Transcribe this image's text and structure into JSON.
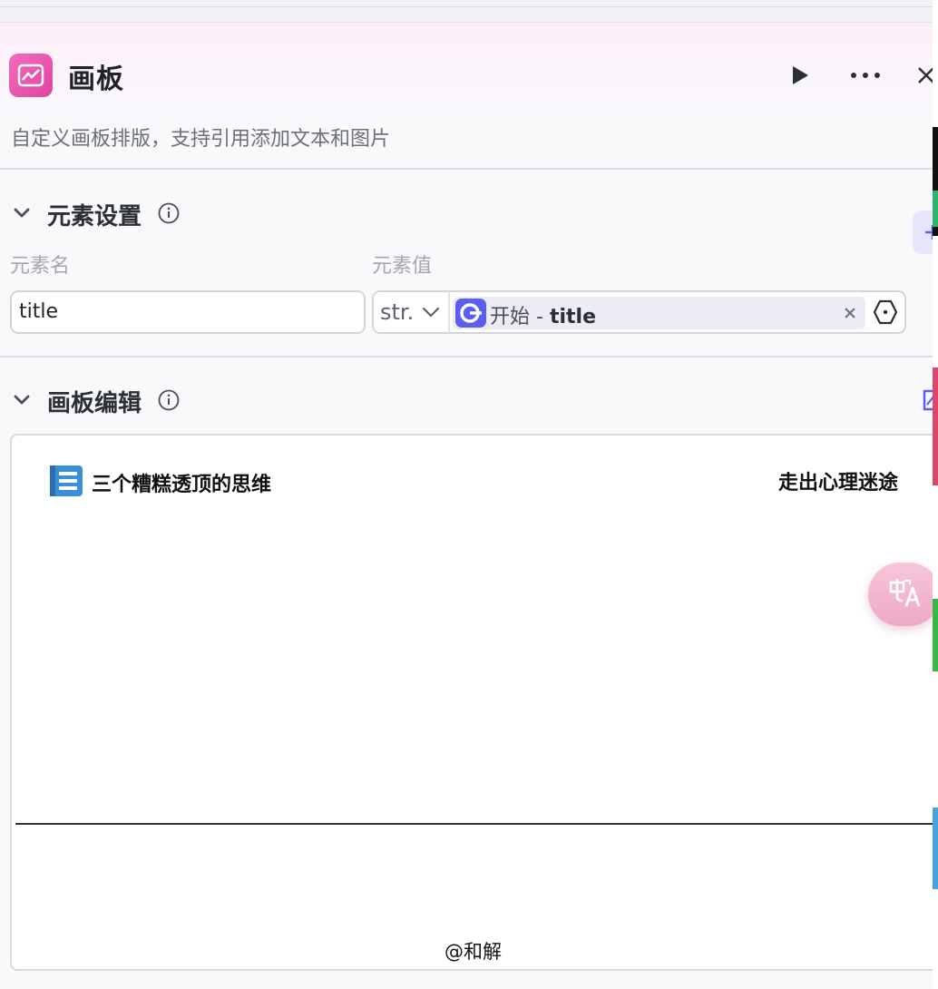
{
  "node": {
    "title": "画板",
    "description": "自定义画板排版，支持引用添加文本和图片",
    "icon": "drawing-board-icon",
    "accent_color": "#e94fa9"
  },
  "header_actions": [
    "run-icon",
    "more-icon",
    "close-icon"
  ],
  "element_settings": {
    "title": "元素设置",
    "name_label": "元素名",
    "value_label": "元素值",
    "row": {
      "name": "title",
      "type": "str.",
      "ref_source": "开始",
      "ref_separator": "-",
      "ref_field": "title"
    }
  },
  "board_edit": {
    "title": "画板编辑",
    "canvas": {
      "title_text": "三个糟糕透顶的思维",
      "right_text": "走出心理迷途",
      "footer_text": "@和解"
    }
  },
  "colors": {
    "ref_icon": "#5b5ef0",
    "translate_button": "#efadc8",
    "list_icon": "#3b8fd6"
  }
}
